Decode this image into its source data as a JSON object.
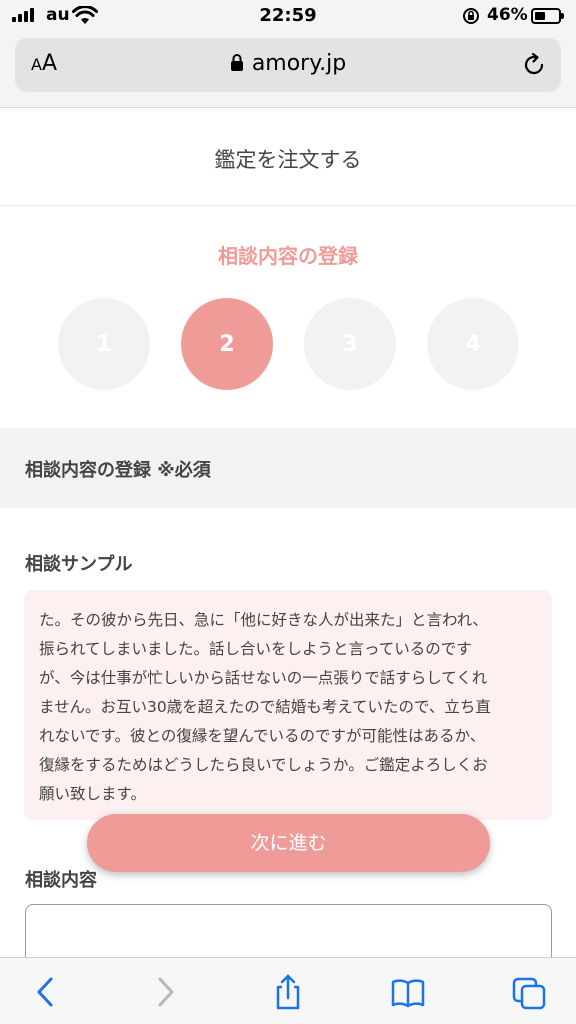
{
  "status_bar": {
    "carrier": "au",
    "time": "22:59",
    "battery_percent": "46%",
    "battery_level": 0.46
  },
  "browser": {
    "text_size_label_small": "A",
    "text_size_label_large": "A",
    "url": "amory.jp",
    "accent_color": "#1a73e8"
  },
  "page": {
    "title": "鑑定を注文する",
    "step_title": "相談内容の登録",
    "steps": [
      {
        "label": "1",
        "active": false
      },
      {
        "label": "2",
        "active": true
      },
      {
        "label": "3",
        "active": false
      },
      {
        "label": "4",
        "active": false
      }
    ],
    "section_title": "相談内容の登録 ※必須",
    "sample_label": "相談サンプル",
    "sample_lines": [
      "た。その彼から先日、急に「他に好きな人が出来た」と言われ、",
      "振られてしまいました。話し合いをしようと言っているのです",
      "が、今は仕事が忙しいから話せないの一点張りで話すらしてくれ",
      "ません。お互い30歳を超えたので結婚も考えていたので、立ち直",
      "れないです。彼との復縁を望んでいるのですが可能性はあるか、",
      "復縁をするためはどうしたら良いでしょうか。ご鑑定よろしくお",
      "願い致します。"
    ],
    "next_button": "次に進む",
    "content_label": "相談内容",
    "content_value": "",
    "theme_color": "#ef9c98"
  },
  "toolbar": {
    "icons": [
      "back-icon",
      "forward-icon",
      "share-icon",
      "bookmarks-icon",
      "tabs-icon"
    ]
  }
}
